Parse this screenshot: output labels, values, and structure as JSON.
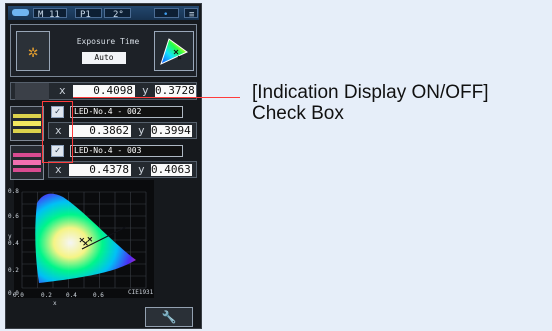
{
  "status_bar": {
    "mode": "M",
    "value_1": "11",
    "profile": "P1",
    "angle": "2°",
    "right_icon": "•",
    "end_icon": "≡"
  },
  "exposure": {
    "title": "Exposure Time",
    "value": "Auto"
  },
  "primary": {
    "x_label": "x",
    "x": "0.4098",
    "y_label": "y",
    "y": "0.3728"
  },
  "leds": [
    {
      "name": "LED-No.4 - 002",
      "x": "0.3862",
      "y": "0.3994",
      "swatch_color": "#e7dd53"
    },
    {
      "name": "LED-No.4 - 003",
      "x": "0.4378",
      "y": "0.4063",
      "swatch_color": "#d85b99"
    }
  ],
  "chart_data": {
    "type": "scatter",
    "title": "",
    "xlabel": "x",
    "ylabel": "y",
    "xlim": [
      0,
      0.8
    ],
    "ylim": [
      0,
      0.8
    ],
    "x_ticks": [
      "0.0",
      "0.2",
      "0.4",
      "0.6"
    ],
    "y_ticks": [
      "0.8",
      "0.6",
      "0.4",
      "0.2",
      "0.0"
    ],
    "corner_label": "CIE1931",
    "series": [
      {
        "values": [
          [
            0.4098,
            0.3728
          ],
          [
            0.3862,
            0.3994
          ],
          [
            0.4378,
            0.4063
          ]
        ]
      }
    ],
    "grid": true
  },
  "annotation": {
    "line1": "[Indication Display ON/OFF]",
    "line2": "Check Box"
  },
  "colors": {
    "accent": "#ff3c3c",
    "background": "#e6eef9"
  }
}
